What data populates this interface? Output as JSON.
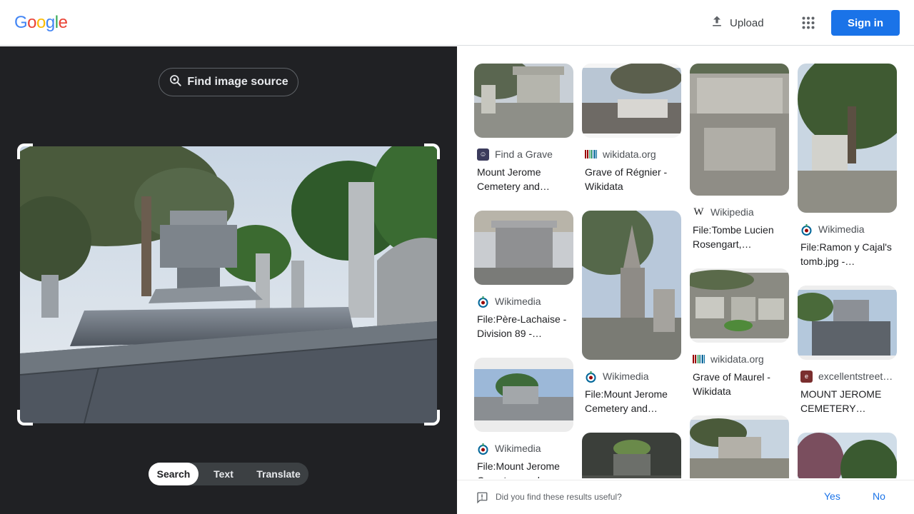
{
  "header": {
    "logo_letters": [
      "G",
      "o",
      "o",
      "g",
      "l",
      "e"
    ],
    "logo_colors": [
      "#4285f4",
      "#ea4335",
      "#fbbc05",
      "#4285f4",
      "#34a853",
      "#ea4335"
    ],
    "upload_label": "Upload",
    "signin_label": "Sign in",
    "apps_icon": "apps-grid-icon"
  },
  "left": {
    "find_source_label": "Find image source",
    "tabs": [
      {
        "label": "Search",
        "active": true
      },
      {
        "label": "Text",
        "active": false
      },
      {
        "label": "Translate",
        "active": false
      }
    ]
  },
  "results": {
    "col1": [
      {
        "source": "Find a Grave",
        "title": "Mount Jerome Cemetery and…",
        "favicon": "findagrave-icon"
      },
      {
        "source": "Wikimedia",
        "title": "File:Père-Lachaise - Division 89 -…",
        "favicon": "wikimedia-icon"
      },
      {
        "source": "Wikimedia",
        "title": "File:Mount Jerome Cemetery and…",
        "favicon": "wikimedia-icon"
      }
    ],
    "col2": [
      {
        "source": "wikidata.org",
        "title": "Grave of Régnier - Wikidata",
        "favicon": "wikidata-icon"
      },
      {
        "source": "Wikimedia",
        "title": "File:Mount Jerome Cemetery and…",
        "favicon": "wikimedia-icon"
      }
    ],
    "col3": [
      {
        "source": "Wikipedia",
        "title": "File:Tombe Lucien Rosengart,…",
        "favicon": "wikipedia-icon"
      },
      {
        "source": "wikidata.org",
        "title": "Grave of Maurel - Wikidata",
        "favicon": "wikidata-icon"
      }
    ],
    "col4": [
      {
        "source": "Wikimedia",
        "title": "File:Ramon y Cajal's tomb.jpg -…",
        "favicon": "wikimedia-icon"
      },
      {
        "source": "excellentstreet…",
        "title": "MOUNT JEROME CEMETERY…",
        "favicon": "excellentstreet-icon"
      }
    ]
  },
  "feedback": {
    "question": "Did you find these results useful?",
    "yes": "Yes",
    "no": "No"
  }
}
